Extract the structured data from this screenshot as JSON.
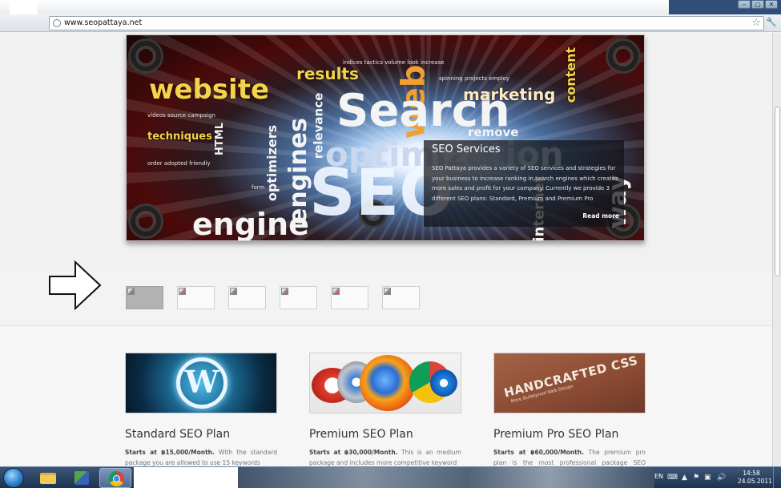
{
  "browser": {
    "url": "www.seopattaya.net",
    "window_buttons": [
      "–",
      "▢",
      "✕"
    ]
  },
  "hero": {
    "words": {
      "website": "website",
      "results": "results",
      "search": "Search",
      "web": "web",
      "optimization": "optimization",
      "seo": "SEO",
      "engines": "engines",
      "engine": "engine",
      "marketing": "marketing",
      "techniques": "techniques",
      "optimizers": "optimizers",
      "relevance": "relevance",
      "content": "content",
      "internet": "internet",
      "way": "way",
      "small1": "indices tactics volume look increase",
      "small2": "spinning projects employ",
      "small3": "videos source campaign",
      "small4": "order adopted friendly",
      "html": "HTML",
      "remove": "remove",
      "form": "form"
    },
    "caption": {
      "title": "SEO Services",
      "body": "SEO Pattaya provides a variety of SEO services and strategies for your business to increase ranking in search engines which creates more sales and profit for your company. Currently we provide 3 different SEO plans: Standard, Premium and Premium Pro",
      "read_more": "Read more"
    }
  },
  "thumbnails": {
    "count": 6,
    "active_index": 0
  },
  "plans": [
    {
      "title": "Standard SEO Plan",
      "price_label": "Starts at ฿15,000/Month.",
      "desc": "With the standard package you are allowed to use 15 keywords"
    },
    {
      "title": "Premium SEO Plan",
      "price_label": "Starts at ฿30,000/Month.",
      "desc": "This is an medium package and includes more competitive keyword"
    },
    {
      "title": "Premium Pro SEO Plan",
      "price_label": "Starts at ฿60,000/Month.",
      "desc": "The premium pro plan is the most professional package SEO Pattaya"
    }
  ],
  "plan_images": {
    "wp_letter": "W",
    "handcrafted": "HANDCRAFTED CSS",
    "handcrafted_sub": "More Bulletproof Web Design"
  },
  "taskbar": {
    "language": "EN",
    "time": "14:58",
    "date": "24.05.2011"
  }
}
